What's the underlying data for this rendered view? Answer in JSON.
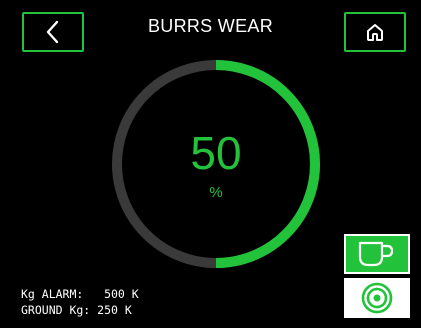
{
  "header": {
    "title": "BURRS WEAR",
    "back_icon": "chevron-left-icon",
    "home_icon": "home-icon"
  },
  "gauge": {
    "value": "50",
    "unit": "%",
    "percent": 50,
    "track_color": "#3a3a3a",
    "fill_color": "#22c33a"
  },
  "info": {
    "alarm": "Kg ALARM:   500 K",
    "ground": "GROUND Kg: 250 K"
  },
  "side_buttons": {
    "cup_icon": "cup-icon",
    "grind_icon": "spiral-logo-icon"
  },
  "colors": {
    "accent": "#22c33a",
    "background": "#000000",
    "text": "#ffffff"
  }
}
